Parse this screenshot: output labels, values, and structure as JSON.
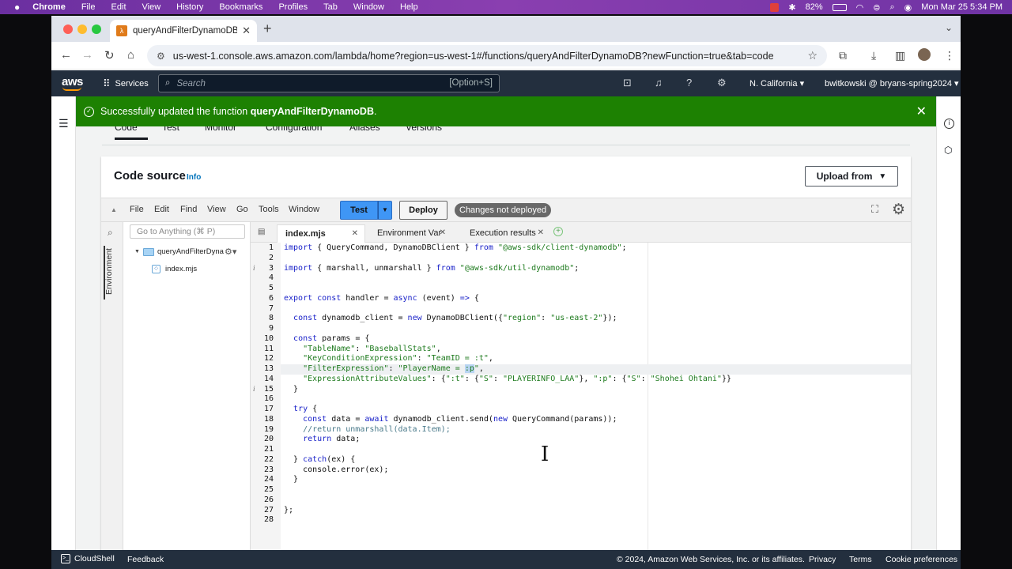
{
  "menubar": {
    "items": [
      "Chrome",
      "File",
      "Edit",
      "View",
      "History",
      "Bookmarks",
      "Profiles",
      "Tab",
      "Window",
      "Help"
    ],
    "battery": "82%",
    "datetime": "Mon Mar 25  5:34 PM"
  },
  "browser": {
    "tab_title": "queryAndFilterDynamoDB - L",
    "url": "us-west-1.console.aws.amazon.com/lambda/home?region=us-west-1#/functions/queryAndFilterDynamoDB?newFunction=true&tab=code"
  },
  "aws": {
    "logo": "aws",
    "services_label": "Services",
    "search_placeholder": "Search",
    "search_shortcut": "[Option+S]",
    "region": "N. California",
    "account": "bwitkowski @ bryans-spring2024"
  },
  "flash": {
    "prefix": "Successfully updated the function ",
    "function_name": "queryAndFilterDynamoDB",
    "suffix": "."
  },
  "function_tabs": [
    "Code",
    "Test",
    "Monitor",
    "Configuration",
    "Aliases",
    "Versions"
  ],
  "panel": {
    "title": "Code source",
    "info": "Info",
    "upload_label": "Upload from"
  },
  "ide": {
    "menu": [
      "File",
      "Edit",
      "Find",
      "View",
      "Go",
      "Tools",
      "Window"
    ],
    "test_label": "Test",
    "deploy_label": "Deploy",
    "status_badge": "Changes not deployed",
    "goto_placeholder": "Go to Anything (⌘ P)",
    "environment_label": "Environment",
    "folder_name": "queryAndFilterDyna",
    "file_name": "index.mjs",
    "tabs": [
      "index.mjs",
      "Environment Var",
      "Execution results"
    ]
  },
  "code": {
    "lines": [
      "import { QueryCommand, DynamoDBClient } from \"@aws-sdk/client-dynamodb\";",
      "",
      "import { marshall, unmarshall } from \"@aws-sdk/util-dynamodb\";",
      "",
      "",
      "export const handler = async (event) => {",
      "",
      "  const dynamodb_client = new DynamoDBClient({\"region\": \"us-east-2\"});",
      "",
      "  const params = {",
      "    \"TableName\": \"BaseballStats\",",
      "    \"KeyConditionExpression\": \"TeamID = :t\",",
      "    \"FilterExpression\": \"PlayerName = :p\",",
      "    \"ExpressionAttributeValues\": {\":t\": {\"S\": \"PLAYERINFO_LAA\"}, \":p\": {\"S\": \"Shohei Ohtani\"}}",
      "  }",
      "",
      "  try {",
      "    const data = await dynamodb_client.send(new QueryCommand(params));",
      "    //return unmarshall(data.Item);",
      "    return data;",
      "",
      "  } catch(ex) {",
      "    console.error(ex);",
      "  }",
      "",
      "",
      "};",
      ""
    ]
  },
  "footer": {
    "cloudshell": "CloudShell",
    "feedback": "Feedback",
    "copyright": "© 2024, Amazon Web Services, Inc. or its affiliates.",
    "privacy": "Privacy",
    "terms": "Terms",
    "cookies": "Cookie preferences"
  }
}
